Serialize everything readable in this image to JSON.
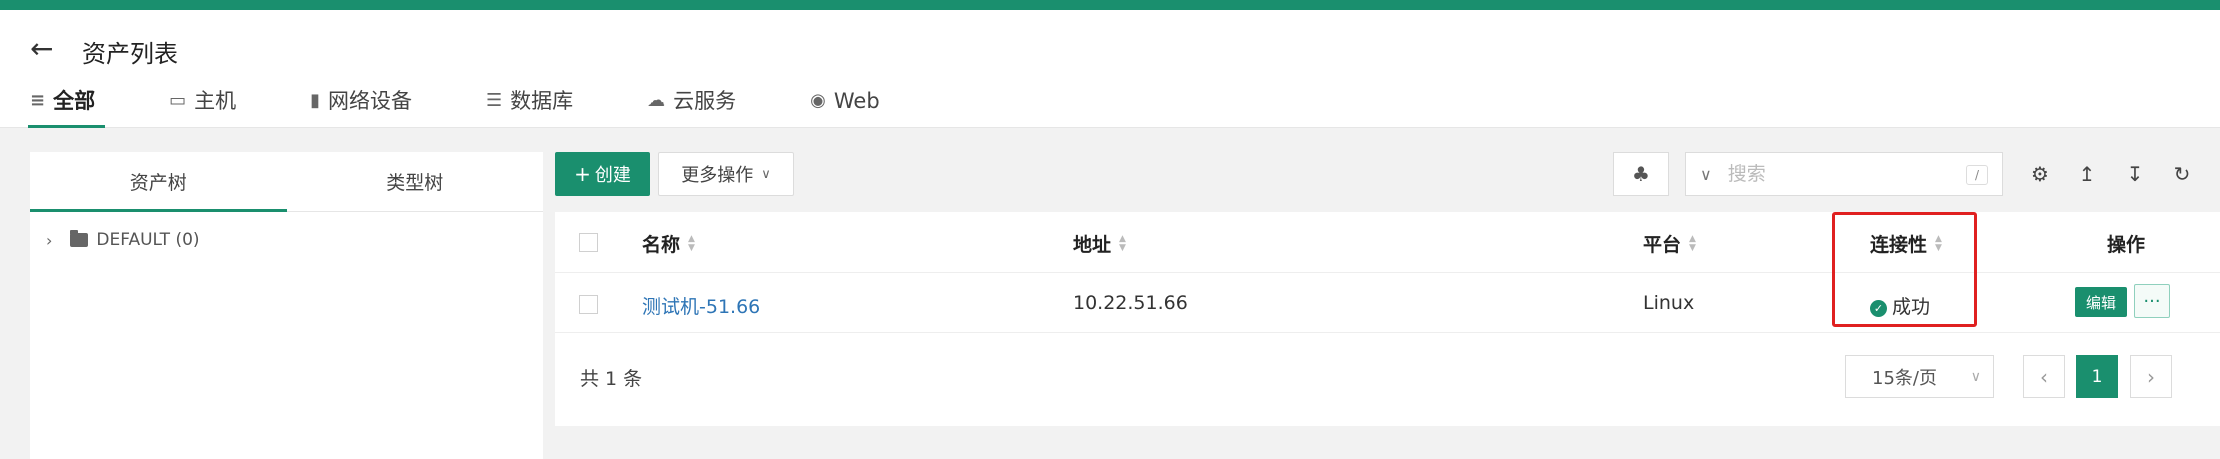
{
  "header": {
    "back_icon": "arrow-left-icon",
    "title": "资产列表",
    "tabs": [
      {
        "label": "全部",
        "icon": "list-icon"
      },
      {
        "label": "主机",
        "icon": "inbox-icon"
      },
      {
        "label": "网络设备",
        "icon": "chip-icon"
      },
      {
        "label": "数据库",
        "icon": "database-icon"
      },
      {
        "label": "云服务",
        "icon": "cloud-icon"
      },
      {
        "label": "Web",
        "icon": "globe-icon"
      }
    ]
  },
  "sidebar": {
    "tabs": [
      "资产树",
      "类型树"
    ],
    "tree": [
      {
        "label": "DEFAULT (0)"
      }
    ]
  },
  "toolbar": {
    "create_label": "创建",
    "more_label": "更多操作",
    "search_placeholder": "搜索",
    "search_shortcut": "/"
  },
  "table": {
    "columns": [
      "名称",
      "地址",
      "平台",
      "连接性",
      "操作"
    ],
    "rows": [
      {
        "name": "测试机-51.66",
        "address": "10.22.51.66",
        "platform": "Linux",
        "connectivity": "成功",
        "edit_label": "编辑",
        "more_label": "···"
      }
    ]
  },
  "pagination": {
    "total_text": "共 1 条",
    "page_size": "15条/页",
    "current_page": "1"
  },
  "colors": {
    "primary": "#1a8f6e",
    "highlight": "#e02020",
    "link": "#2e75b6"
  }
}
